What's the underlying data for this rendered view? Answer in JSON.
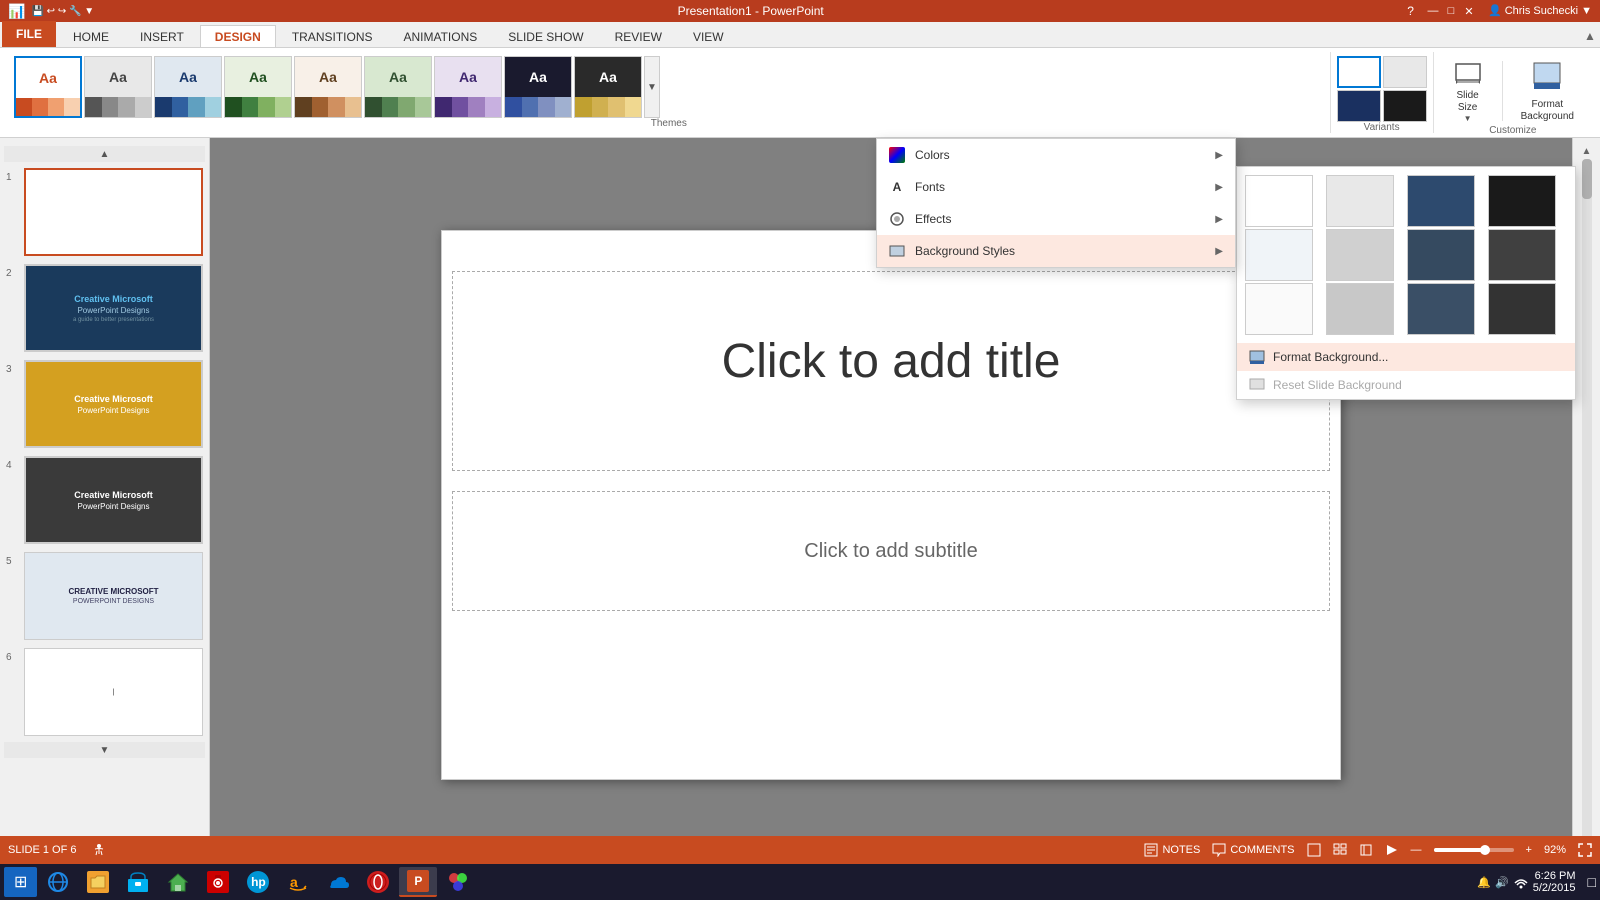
{
  "titlebar": {
    "title": "Presentation1 - PowerPoint",
    "minimize": "—",
    "maximize": "□",
    "close": "✕"
  },
  "tabs": [
    {
      "label": "FILE",
      "id": "file",
      "type": "file"
    },
    {
      "label": "HOME",
      "id": "home"
    },
    {
      "label": "INSERT",
      "id": "insert"
    },
    {
      "label": "DESIGN",
      "id": "design",
      "active": true
    },
    {
      "label": "TRANSITIONS",
      "id": "transitions"
    },
    {
      "label": "ANIMATIONS",
      "id": "animations"
    },
    {
      "label": "SLIDE SHOW",
      "id": "slideshow"
    },
    {
      "label": "REVIEW",
      "id": "review"
    },
    {
      "label": "VIEW",
      "id": "view"
    }
  ],
  "ribbon": {
    "themes_label": "Themes",
    "customize_label": "Customize",
    "slide_size_label": "Slide\nSize",
    "format_background_label": "Format\nBackground"
  },
  "themes_menu": {
    "items": [
      {
        "label": "Colors",
        "id": "colors",
        "has_arrow": true
      },
      {
        "label": "Fonts",
        "id": "fonts",
        "has_arrow": true
      },
      {
        "label": "Effects",
        "id": "effects",
        "has_arrow": true
      },
      {
        "label": "Background Styles",
        "id": "bg_styles",
        "has_arrow": true,
        "highlighted": true
      }
    ]
  },
  "bg_dropdown": {
    "swatches": [
      {
        "class": "white",
        "row": 1,
        "col": 1
      },
      {
        "class": "light-gray",
        "row": 1,
        "col": 2
      },
      {
        "class": "dark-blue",
        "row": 1,
        "col": 3
      },
      {
        "class": "black",
        "row": 1,
        "col": 4
      },
      {
        "class": "light-blue",
        "row": 2,
        "col": 1
      },
      {
        "class": "gray2",
        "row": 2,
        "col": 2
      },
      {
        "class": "navy",
        "row": 2,
        "col": 3
      },
      {
        "class": "dark-gray",
        "row": 2,
        "col": 4
      },
      {
        "class": "white2",
        "row": 3,
        "col": 1
      },
      {
        "class": "silver",
        "row": 3,
        "col": 2
      },
      {
        "class": "slate",
        "row": 3,
        "col": 3
      },
      {
        "class": "charcoal",
        "row": 3,
        "col": 4
      }
    ],
    "format_background_label": "Format Background...",
    "reset_label": "Reset Slide Background"
  },
  "slide_panel": {
    "slides": [
      {
        "num": 1,
        "theme": "slide1",
        "active": true
      },
      {
        "num": 2,
        "theme": "slide2"
      },
      {
        "num": 3,
        "theme": "slide3"
      },
      {
        "num": 4,
        "theme": "slide4"
      },
      {
        "num": 5,
        "theme": "slide5"
      },
      {
        "num": 6,
        "theme": "slide6"
      }
    ]
  },
  "canvas": {
    "title_placeholder": "Click to add title",
    "subtitle_placeholder": "Click to add subtitle"
  },
  "statusbar": {
    "slide_info": "SLIDE 1 OF 6",
    "notes_label": "NOTES",
    "comments_label": "COMMENTS",
    "zoom_level": "92%"
  },
  "taskbar": {
    "time": "6:26 PM",
    "date": "5/2/2015",
    "start_label": "⊞"
  }
}
